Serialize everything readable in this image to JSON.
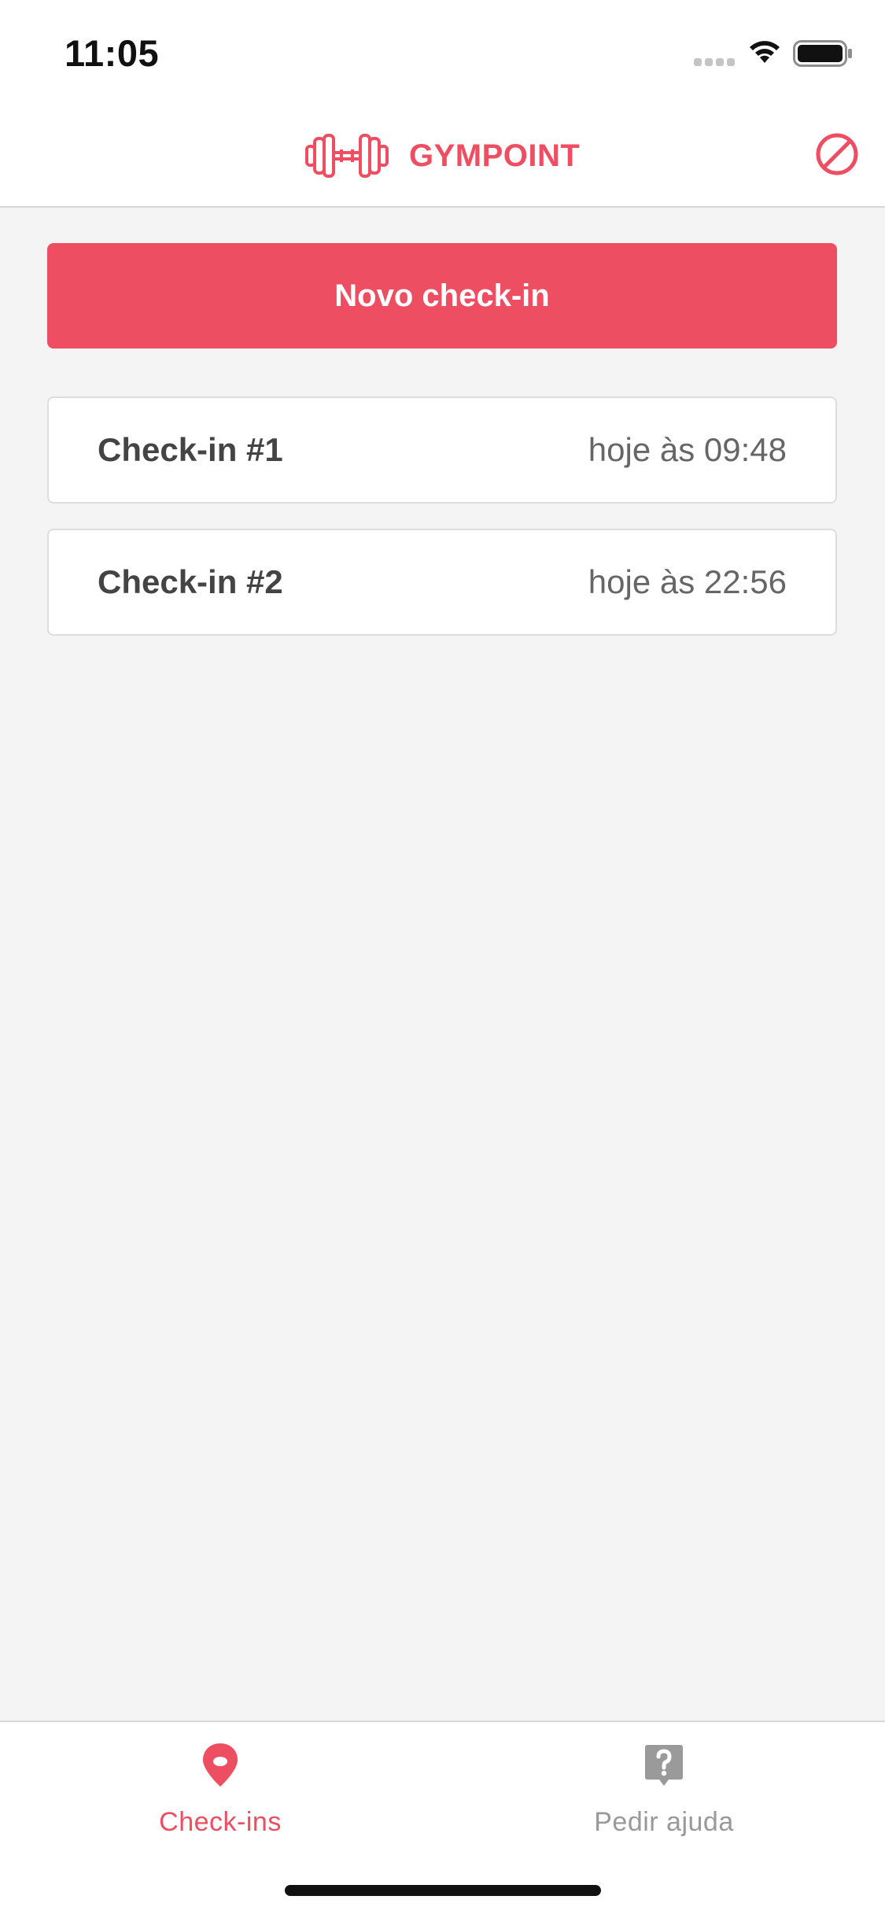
{
  "status_bar": {
    "time": "11:05",
    "icons": [
      "cellular-signal-icon",
      "wifi-icon",
      "battery-icon"
    ]
  },
  "header": {
    "brand_icon": "dumbbell-icon",
    "brand_name": "GYMPOINT",
    "logout_icon": "prohibited-icon"
  },
  "actions": {
    "new_checkin_label": "Novo check-in"
  },
  "checkins": [
    {
      "title": "Check-in #1",
      "time": "hoje às 09:48"
    },
    {
      "title": "Check-in #2",
      "time": "hoje às 22:56"
    }
  ],
  "tabs": [
    {
      "label": "Check-ins",
      "icon": "location-pin-icon",
      "active": true
    },
    {
      "label": "Pedir ajuda",
      "icon": "help-question-icon",
      "active": false
    }
  ],
  "colors": {
    "accent": "#ee4e62",
    "background": "#f4f4f4",
    "surface": "#ffffff",
    "inactive": "#999999"
  }
}
